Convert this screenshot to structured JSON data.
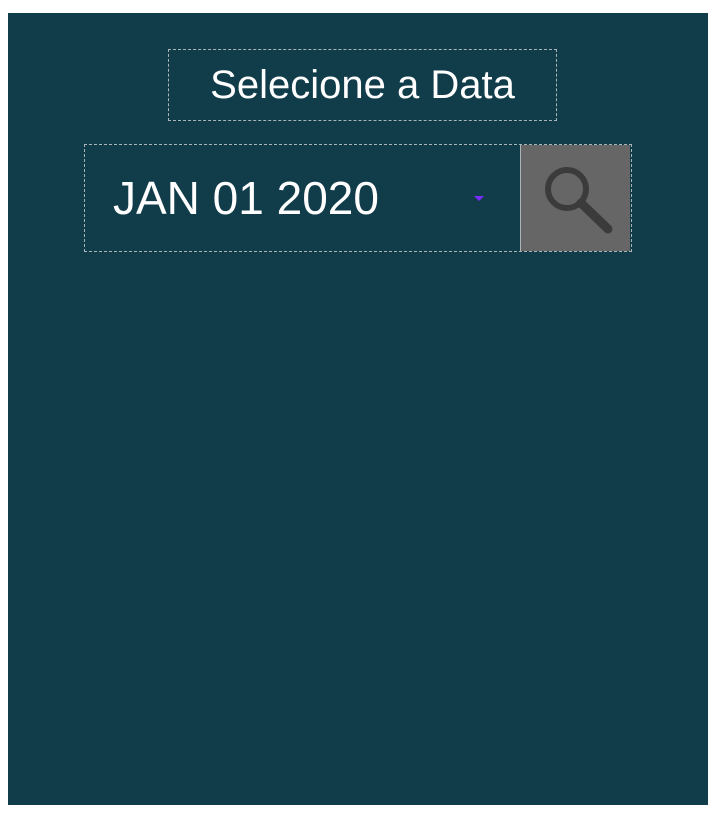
{
  "header": {
    "title": "Selecione a Data"
  },
  "date_picker": {
    "selected_value": "JAN 01 2020",
    "arrow_icon": "dropdown-arrow-icon"
  },
  "search_button": {
    "icon": "search-icon"
  },
  "colors": {
    "background": "#113c4a",
    "text": "#ffffff",
    "button_background": "#666666",
    "dropdown_arrow": "#7a2cff",
    "border": "#a9b5b9"
  }
}
